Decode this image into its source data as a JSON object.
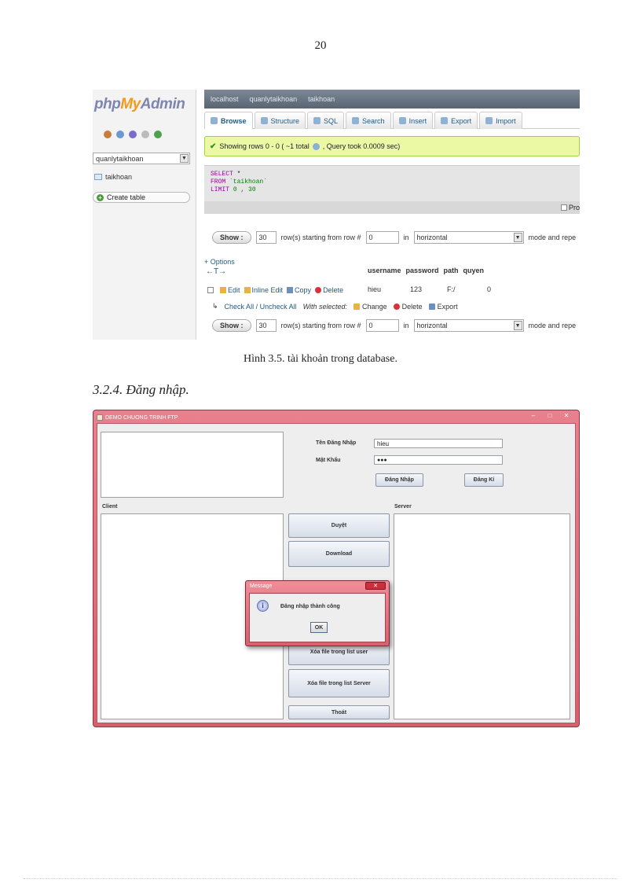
{
  "page": {
    "number": "20"
  },
  "phpmyadmin": {
    "logo": {
      "php": "php",
      "my": "My",
      "admin": "Admin"
    },
    "sidebar": {
      "icon_colors": [
        "#c87d3a",
        "#6a9ad1",
        "#7b6cc9",
        "#bbbbbb",
        "#4fa04f"
      ],
      "database_select": "quanlytaikhoan",
      "table_item": "taikhoan",
      "create_table": "Create table"
    },
    "breadcrumb": [
      "localhost",
      "quanlytaikhoan",
      "taikhoan"
    ],
    "tabs": [
      {
        "label": "Browse",
        "active": true
      },
      {
        "label": "Structure",
        "active": false
      },
      {
        "label": "SQL",
        "active": false
      },
      {
        "label": "Search",
        "active": false
      },
      {
        "label": "Insert",
        "active": false
      },
      {
        "label": "Export",
        "active": false
      },
      {
        "label": "Import",
        "active": false
      }
    ],
    "success_message": {
      "before": "Showing rows 0 - 0 ( ~1 total",
      "after": ", Query took 0.0009 sec)"
    },
    "sql": {
      "line1_kw": "SELECT",
      "line1_rest": " *",
      "line2_kw": "FROM",
      "line2_rest": " `taikhoan`",
      "line3_kw": "LIMIT",
      "line3_rest": " 0 , 30"
    },
    "profiling_label": "Pro",
    "nav": {
      "show_label": "Show :",
      "rows_value": "30",
      "rows_text": "row(s) starting from row #",
      "start_value": "0",
      "in_text": "in",
      "mode_value": "horizontal",
      "repeat_text": "mode and repe"
    },
    "options_link": "+ Options",
    "arrows": "←T→",
    "table": {
      "columns": [
        "username",
        "password",
        "path",
        "quyen"
      ],
      "row_actions": [
        "Edit",
        "Inline Edit",
        "Copy",
        "Delete"
      ],
      "rows": [
        {
          "username": "hieu",
          "password": "123",
          "path": "F:/",
          "quyen": "0"
        }
      ]
    },
    "footer": {
      "check_all": "Check All / Uncheck All",
      "with_selected": "With selected:",
      "change": "Change",
      "delete": "Delete",
      "export": "Export"
    }
  },
  "caption": "Hình 3.5. tài khoản trong database.",
  "section_title": "3.2.4. Đăng nhập.",
  "ftp_app": {
    "window_title": "DEMO CHUONG TRINH FTP",
    "window_controls": [
      "–",
      "□",
      "✕"
    ],
    "username_label": "Tên Đăng Nhập",
    "username_value": "hieu",
    "password_label": "Mật Khẩu",
    "password_value": "●●●",
    "login_button": "Đăng Nhập",
    "register_button": "Đăng Kí",
    "client_label": "Client",
    "server_label": "Server",
    "buttons": {
      "browse": "Duyệt",
      "download": "Download",
      "delete_user_file": "Xóa file trong list user",
      "delete_server_file": "Xóa file trong list Server",
      "exit": "Thoát"
    },
    "dialog": {
      "title": "Message",
      "close": "✕",
      "icon_glyph": "i",
      "message": "Đăng nhập thành công",
      "ok": "OK"
    }
  }
}
